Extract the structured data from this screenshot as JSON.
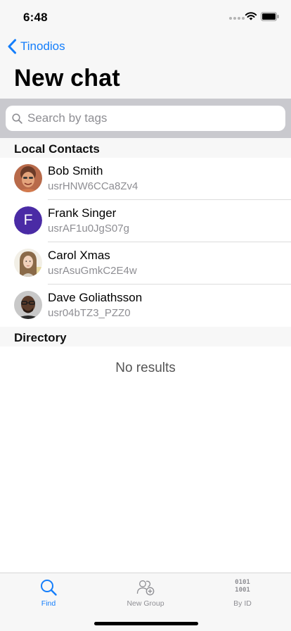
{
  "status_bar": {
    "time": "6:48"
  },
  "nav": {
    "back_label": "Tinodios",
    "title": "New chat"
  },
  "search": {
    "placeholder": "Search by tags",
    "value": ""
  },
  "sections": {
    "local_contacts": "Local Contacts",
    "directory": "Directory"
  },
  "contacts": [
    {
      "name": "Bob Smith",
      "id": "usrHNW6CCa8Zv4",
      "avatar": "photo"
    },
    {
      "name": "Frank Singer",
      "id": "usrAF1u0JgS07g",
      "avatar": "letter",
      "initial": "F",
      "color": "#4a2ba5"
    },
    {
      "name": "Carol Xmas",
      "id": "usrAsuGmkC2E4w",
      "avatar": "photo"
    },
    {
      "name": "Dave Goliathsson",
      "id": "usr04bTZ3_PZZ0",
      "avatar": "photo"
    }
  ],
  "directory": {
    "empty_text": "No results"
  },
  "tab_bar": {
    "tabs": [
      {
        "label": "Find",
        "icon": "search-icon",
        "selected": true
      },
      {
        "label": "New Group",
        "icon": "add-group-icon",
        "selected": false
      },
      {
        "label": "By ID",
        "icon": "binary-icon",
        "selected": false,
        "glyph_lines": [
          "0101",
          "1001"
        ]
      }
    ]
  },
  "colors": {
    "accent": "#147efb",
    "inactive": "#8e8e93",
    "separator": "#dcdcdc"
  }
}
